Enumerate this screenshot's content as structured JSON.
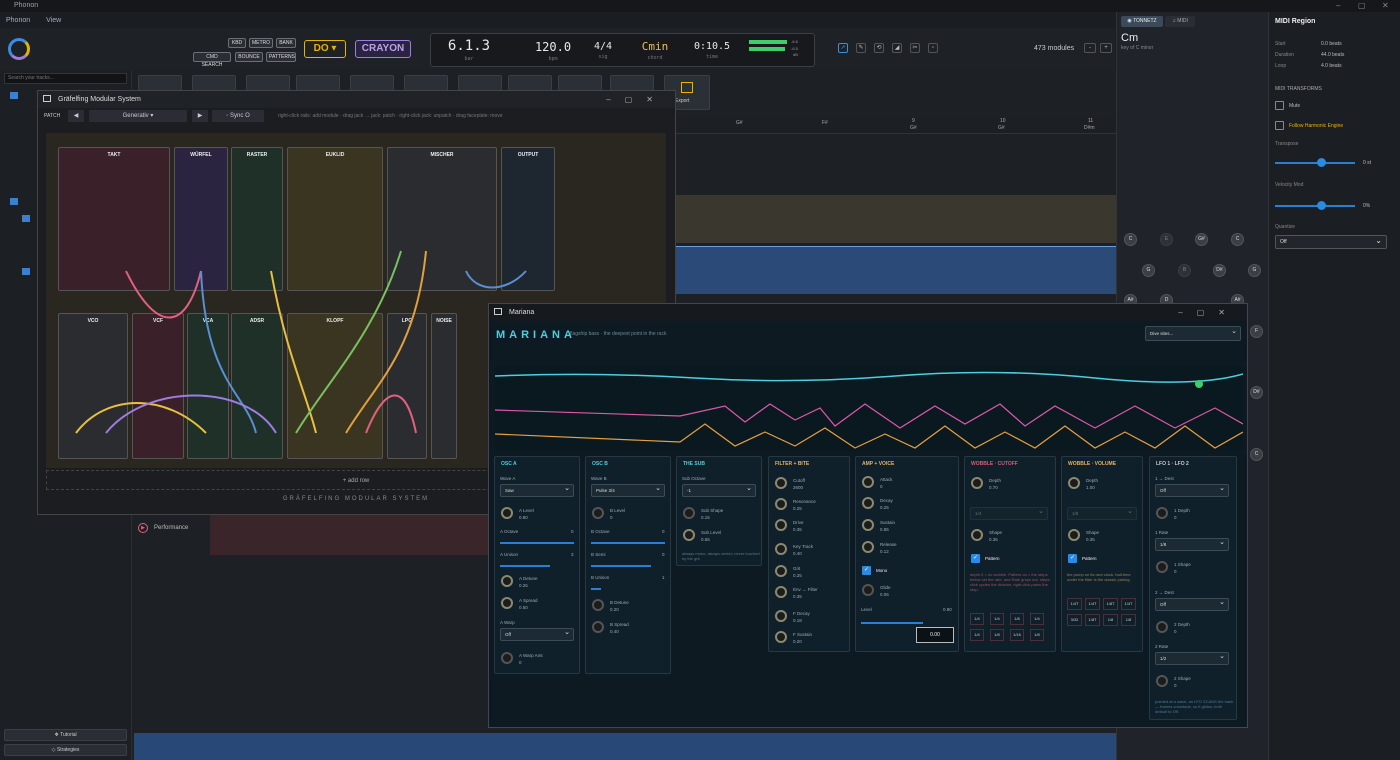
{
  "app": {
    "title": "Phonon",
    "menus": [
      "Phonon",
      "View"
    ]
  },
  "toolbar": {
    "small_buttons": [
      "KBD",
      "METRO",
      "BANK",
      "CMD SEARCH",
      "BOUNCE",
      "PATTERNS"
    ],
    "do_label": "DO ▾",
    "crayon_label": "CRAYON",
    "export_label": "Export",
    "modules_count": "473 modules"
  },
  "transport": {
    "position": "6.1.3",
    "position_label": "bar",
    "tempo": "120.0",
    "tempo_label": "bpm",
    "sig": "4/4",
    "sig_label": "sig",
    "key": "Cmin",
    "key_label": "chord",
    "time": "0:10.5",
    "time_label": "time",
    "meter_db": "-6.6",
    "meter_db2": "-6.5",
    "meter_label": "dB"
  },
  "left": {
    "search_placeholder": "Search your tracks...",
    "tutorial": "❖ Tutorial",
    "strategies": "◇ Strategies"
  },
  "arranger": {
    "performance_label": "Performance",
    "ruler": [
      {
        "n": "",
        "c": "G#"
      },
      {
        "n": "",
        "c": "F#"
      },
      {
        "n": "9",
        "c": "G#"
      },
      {
        "n": "10",
        "c": "G#"
      },
      {
        "n": "11",
        "c": "D#m"
      }
    ]
  },
  "tonnetz": {
    "tab1": "◉ TONNETZ",
    "tab2": "♫ MIDI",
    "chord": "Cm",
    "chord_sub": "key of C minor",
    "nodes": [
      "C",
      "E",
      "G#",
      "C",
      "G",
      "B",
      "D#",
      "G",
      "A#",
      "D",
      "A#",
      "F",
      "D#",
      "C"
    ]
  },
  "region": {
    "title": "MIDI Region",
    "start_l": "Start",
    "start_v": "0.0 beats",
    "dur_l": "Duration",
    "dur_v": "44.0 beats",
    "loop_l": "Loop",
    "loop_v": "4.0 beats",
    "transforms": "MIDI TRANSFORMS",
    "mute": "Mute",
    "follow": "Follow Harmonic Engine",
    "transpose_l": "Transpose",
    "transpose_v": "0 st",
    "velocity_l": "Velocity Mod",
    "velocity_v": "0%",
    "quantize_l": "Quantize",
    "quantize_v": "Off"
  },
  "modular": {
    "title": "Gräfelfing Modular System",
    "patch": "PATCH",
    "preset": "Generativ ▾",
    "sync": "◦ Sync O",
    "hint": "right-click rails: add module · drag jack → jack: patch · right-click jack: unpatch · drag faceplate: move",
    "footer": "GRÄFELFING MODULAR SYSTEM",
    "add_row": "+ add row",
    "modules_top": [
      "TAKT",
      "WÜRFEL",
      "RASTER",
      "EUKLID",
      "MISCHER",
      "OUTPUT"
    ],
    "modules_bottom": [
      "VCO",
      "VCF",
      "VCA",
      "ADSR",
      "KLOPF",
      "LPG",
      "NOISE"
    ]
  },
  "mariana": {
    "title": "Mariana",
    "brand": "MARIANA",
    "tagline": "flagship bass · the deepest point in the rack",
    "dive": "Dive sites...",
    "osca": {
      "t": "OSC A",
      "wave_l": "Wave A",
      "wave": "Saw",
      "level_l": "A Level",
      "level": "0.80",
      "oct_l": "A Octave",
      "oct": "0",
      "uni_l": "A Unison",
      "uni": "3",
      "detune_l": "A Detune",
      "detune": "0.25",
      "spread_l": "A Spread",
      "spread": "0.50",
      "warp_l": "A Warp",
      "warp": "Off",
      "warpamt_l": "A Warp Amt",
      "warpamt": "0"
    },
    "oscb": {
      "t": "OSC B",
      "wave_l": "Wave B",
      "wave": "Pulse 3/4",
      "level_l": "B Level",
      "level": "0",
      "oct_l": "B Octave",
      "oct": "0",
      "semi_l": "B Semi",
      "semi": "0",
      "uni_l": "B Unison",
      "uni": "1",
      "detune_l": "B Detune",
      "detune": "0.20",
      "spread_l": "B Spread",
      "spread": "0.40"
    },
    "sub": {
      "t": "THE SUB",
      "oct_l": "Sub Octave",
      "oct": "-1",
      "shape_l": "Sub Shape",
      "shape": "0.15",
      "level_l": "Sub Level",
      "level": "0.55",
      "note": "always mono; always center; never touched by the grit"
    },
    "filter": {
      "t": "FILTER + BITE",
      "items": [
        [
          "Cutoff",
          "2600"
        ],
        [
          "Resonance",
          "0.25"
        ],
        [
          "Drive",
          "0.35"
        ],
        [
          "Key Track",
          "0.40"
        ],
        [
          "Grit",
          "0.25"
        ],
        [
          "Env → Filter",
          "0.35"
        ],
        [
          "F Decay",
          "0.18"
        ],
        [
          "F Sustain",
          "0.20"
        ]
      ]
    },
    "amp": {
      "t": "AMP + VOICE",
      "items": [
        [
          "Attack",
          "0"
        ],
        [
          "Decay",
          "0.25"
        ],
        [
          "Sustain",
          "0.85"
        ],
        [
          "Release",
          "0.12"
        ]
      ],
      "mono": "Mono",
      "glide_l": "Glide",
      "glide": "0.05",
      "level_l": "Level",
      "level": "0.80",
      "value": "0.00"
    },
    "wcut": {
      "t": "WOBBLE · CUTOFF",
      "depth_l": "Depth",
      "depth": "0.70",
      "rate": "1/4",
      "shape_l": "Shape",
      "shape": "0.35",
      "pattern": "Pattern",
      "note": "depth 0 = no wobble. Pattern on = the steps below set the rate, and Rate greys out. steps: click cycles the division, right-click parks the step.",
      "steps": [
        "1/4",
        "1/4",
        "1/8",
        "1/4",
        "1/4",
        "1/8",
        "1/16",
        "1/8"
      ]
    },
    "wvol": {
      "t": "WOBBLE · VOLUME",
      "depth_l": "Depth",
      "depth": "1.00",
      "rate": "1/8",
      "shape_l": "Shape",
      "shape": "0.35",
      "pattern": "Pattern",
      "note": "the pump on its own clock. half-time under the filter is the classic pairing.",
      "steps": [
        "1/4T",
        "1/4T",
        "1/8T",
        "1/4T",
        "3/32",
        "1/8T",
        "1/8",
        "1/8"
      ]
    },
    "lfo": {
      "t": "LFO 1 · LFO 2",
      "d1_l": "1 → Dest",
      "d1": "Off",
      "dep1_l": "1 Depth",
      "dep1": "0",
      "rate1_l": "1 Rate",
      "rate1": "1/8",
      "sh1_l": "1 Shape",
      "sh1": "0",
      "d2_l": "2 → Dest",
      "d2": "Off",
      "dep2_l": "2 Depth",
      "dep2": "0",
      "rate2_l": "2 Rate",
      "rate2": "1/2",
      "sh2_l": "2 Shape",
      "sh2": "0",
      "note": "pointed at a wave, an LFO SCANS the bank — frames crossfade, so it glides; both default to Off."
    }
  },
  "colors": {
    "accent": "#2a8be0",
    "do": "#e8b400",
    "crayon": "#9d7de0",
    "cyan": "#4ad0e0",
    "pink": "#e058a8",
    "orange": "#e8a040"
  }
}
